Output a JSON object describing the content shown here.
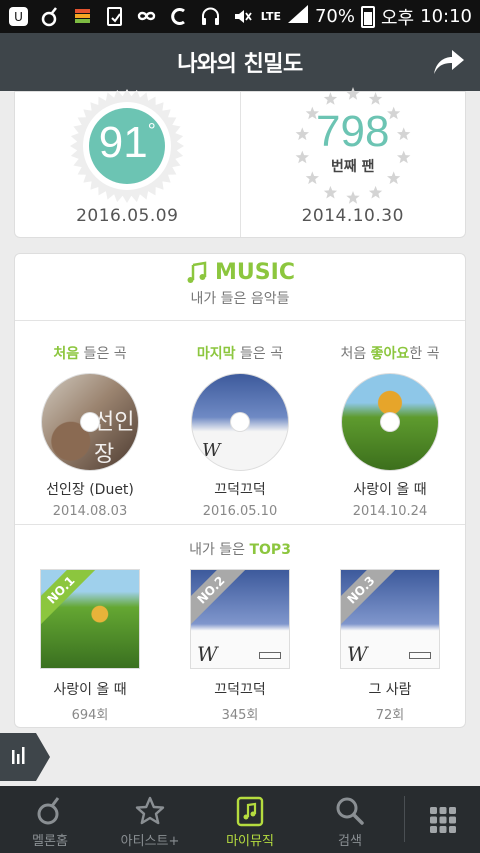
{
  "status_bar": {
    "battery": "70%",
    "ampm": "오후",
    "time": "10:10",
    "network": "LTE"
  },
  "header": {
    "title": "나와의 친밀도"
  },
  "stats": {
    "degree": {
      "value": "91",
      "unit": "°",
      "date": "2016.05.09"
    },
    "fan": {
      "number": "798",
      "label": "번째 팬",
      "date": "2014.10.30"
    }
  },
  "music": {
    "title": "MUSIC",
    "subtitle": "내가 들은 음악들",
    "firsts": [
      {
        "label_hl": "처음",
        "label_rest": " 들은 곡",
        "song": "선인장 (Duet)",
        "date": "2014.08.03"
      },
      {
        "label_hl": "마지막",
        "label_rest": " 들은 곡",
        "song": "끄덕끄덕",
        "date": "2016.05.10"
      },
      {
        "label_pre": "처음 ",
        "label_hl": "좋아요",
        "label_rest": "한 곡",
        "song": "사랑이 올 때",
        "date": "2014.10.24"
      }
    ],
    "top3_prefix": "내가 들은 ",
    "top3_hl": "TOP3",
    "top3": [
      {
        "rank": "NO.1",
        "song": "사랑이 올 때",
        "count": "694회"
      },
      {
        "rank": "NO.2",
        "song": "끄덕끄덕",
        "count": "345회"
      },
      {
        "rank": "NO.3",
        "song": "그 사람",
        "count": "72회"
      }
    ]
  },
  "nav": {
    "items": [
      {
        "label": "멜론홈",
        "icon": "melon-icon"
      },
      {
        "label": "아티스트+",
        "icon": "star-icon"
      },
      {
        "label": "마이뮤직",
        "icon": "music-note-icon",
        "active": true
      },
      {
        "label": "검색",
        "icon": "search-icon"
      }
    ],
    "more_icon": "grid-menu-icon"
  },
  "colors": {
    "accent": "#8cc63e",
    "teal": "#6cc4b3",
    "header": "#3e454a",
    "nav": "#282c2f"
  }
}
